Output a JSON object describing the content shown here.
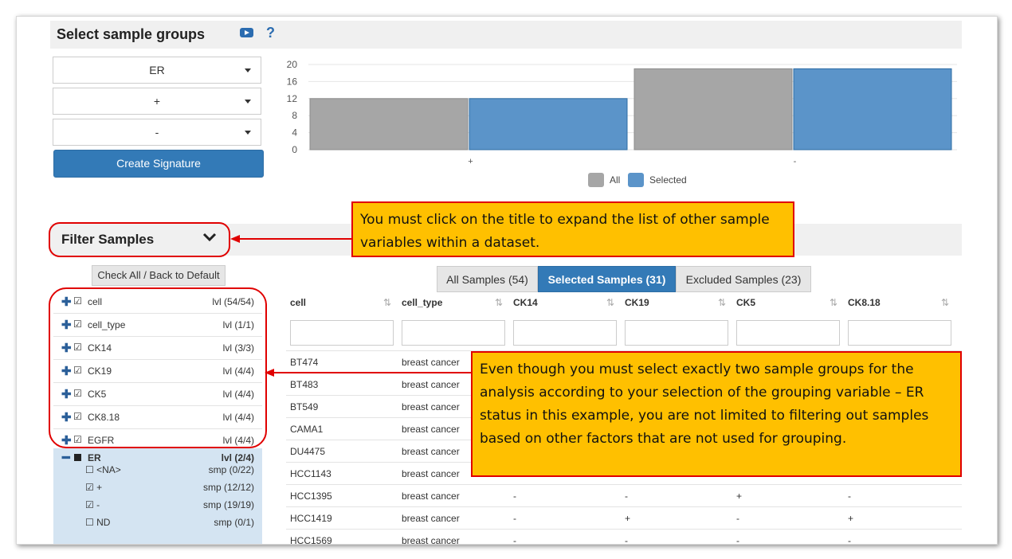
{
  "select_section": {
    "title": "Select sample groups",
    "help": "?"
  },
  "grouping": {
    "variable": "ER",
    "group1": "+",
    "group2": "-",
    "create_button": "Create Signature"
  },
  "chart_data": {
    "type": "bar",
    "categories": [
      "+",
      "-"
    ],
    "series": [
      {
        "name": "All",
        "values": [
          12,
          19
        ],
        "color": "#a6a6a6"
      },
      {
        "name": "Selected",
        "values": [
          12,
          19
        ],
        "color": "#5b94c9"
      }
    ],
    "yticks": [
      0,
      4,
      8,
      12,
      16,
      20
    ],
    "ylim": [
      0,
      20
    ],
    "legend": "bottom-center"
  },
  "filter_section": {
    "title": "Filter Samples",
    "check_all_button": "Check All / Back to Default",
    "variables": [
      {
        "name": "cell",
        "levels": "lvl (54/54)"
      },
      {
        "name": "cell_type",
        "levels": "lvl (1/1)"
      },
      {
        "name": "CK14",
        "levels": "lvl (3/3)"
      },
      {
        "name": "CK19",
        "levels": "lvl (4/4)"
      },
      {
        "name": "CK5",
        "levels": "lvl (4/4)"
      },
      {
        "name": "CK8.18",
        "levels": "lvl (4/4)"
      },
      {
        "name": "EGFR",
        "levels": "lvl (4/4)"
      }
    ],
    "er": {
      "name": "ER",
      "levels": "lvl (2/4)",
      "sub": [
        {
          "label": "<NA>",
          "count": "smp (0/22)",
          "checked": false
        },
        {
          "label": "+",
          "count": "smp (12/12)",
          "checked": true
        },
        {
          "label": "-",
          "count": "smp (19/19)",
          "checked": true
        },
        {
          "label": "ND",
          "count": "smp (0/1)",
          "checked": false
        }
      ]
    }
  },
  "tabs": [
    {
      "label": "All Samples (54)",
      "active": false
    },
    {
      "label": "Selected Samples (31)",
      "active": true
    },
    {
      "label": "Excluded Samples (23)",
      "active": false
    }
  ],
  "table": {
    "columns": [
      "cell",
      "cell_type",
      "CK14",
      "CK19",
      "CK5",
      "CK8.18"
    ],
    "rows": [
      [
        "BT474",
        "breast cancer",
        "",
        "",
        "",
        ""
      ],
      [
        "BT483",
        "breast cancer",
        "",
        "",
        "",
        ""
      ],
      [
        "BT549",
        "breast cancer",
        "",
        "",
        "",
        ""
      ],
      [
        "CAMA1",
        "breast cancer",
        "",
        "",
        "",
        ""
      ],
      [
        "DU4475",
        "breast cancer",
        "",
        "",
        "",
        ""
      ],
      [
        "HCC1143",
        "breast cancer",
        "",
        "",
        "",
        ""
      ],
      [
        "HCC1395",
        "breast cancer",
        "-",
        "-",
        "+",
        "-"
      ],
      [
        "HCC1419",
        "breast cancer",
        "-",
        "+",
        "-",
        "+"
      ],
      [
        "HCC1569",
        "breast cancer",
        "-",
        "-",
        "-",
        "-"
      ]
    ]
  },
  "callouts": {
    "top": "You must click on the title to expand the list of other sample variables within a dataset.",
    "bottom": "Even though you must select exactly two sample groups for the analysis according to your selection of the grouping variable – ER status in this example, you are not limited to filtering out samples based on other factors that are not used for grouping."
  }
}
